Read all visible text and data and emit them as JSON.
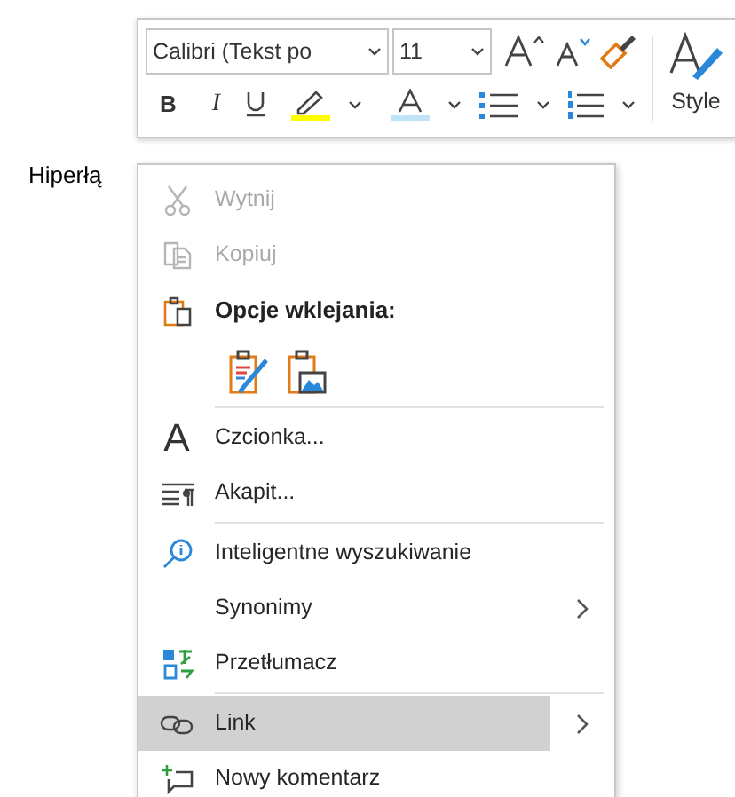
{
  "toolbar": {
    "font_name": "Calibri (Tekst po",
    "font_size": "11",
    "bold_label": "B",
    "italic_label": "I",
    "style_label": "Style"
  },
  "document": {
    "text": "Hiperłą"
  },
  "context_menu": {
    "items": [
      {
        "kind": "item",
        "label": "Wytnij",
        "disabled": true,
        "selected": false,
        "submenu": false
      },
      {
        "kind": "item",
        "label": "Kopiuj",
        "disabled": true,
        "selected": false,
        "submenu": false
      },
      {
        "kind": "heading",
        "label": "Opcje wklejania:"
      },
      {
        "kind": "paste_options"
      },
      {
        "kind": "separator"
      },
      {
        "kind": "item",
        "glyph": "A",
        "label": "Czcionka...",
        "disabled": false,
        "selected": false,
        "submenu": false
      },
      {
        "kind": "item",
        "label": "Akapit...",
        "disabled": false,
        "selected": false,
        "submenu": false
      },
      {
        "kind": "separator"
      },
      {
        "kind": "item",
        "label": "Inteligentne wyszukiwanie",
        "disabled": false,
        "selected": false,
        "submenu": false
      },
      {
        "kind": "item",
        "label": "Synonimy",
        "disabled": false,
        "selected": false,
        "submenu": true
      },
      {
        "kind": "item",
        "label": "Przetłumacz",
        "disabled": false,
        "selected": false,
        "submenu": false
      },
      {
        "kind": "separator"
      },
      {
        "kind": "item",
        "label": "Link",
        "disabled": false,
        "selected": true,
        "submenu": true
      },
      {
        "kind": "item",
        "label": "Nowy komentarz",
        "disabled": false,
        "selected": false,
        "submenu": false
      }
    ]
  }
}
